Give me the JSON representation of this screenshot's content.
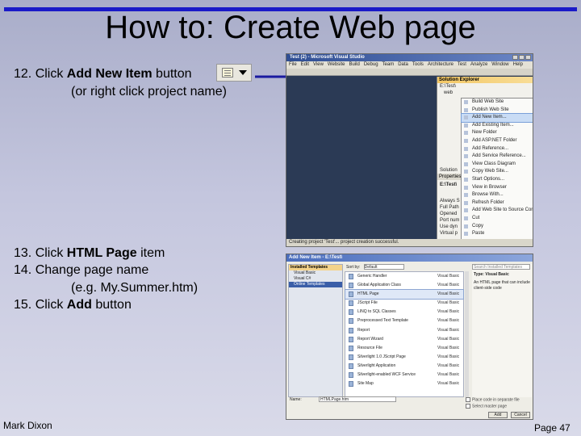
{
  "slide": {
    "title": "How to: Create Web page",
    "step12_prefix": "12. Click ",
    "step12_bold": "Add New Item",
    "step12_suffix": " button",
    "step12_note": "(or right click project name)",
    "step13_prefix": "13. Click ",
    "step13_bold": "HTML Page",
    "step13_suffix": " item",
    "step14": "14. Change page name",
    "step14_example": "(e.g. My.Summer.htm)",
    "step15_prefix": "15. Click ",
    "step15_bold": "Add",
    "step15_suffix": " button",
    "author": "Mark Dixon",
    "page": "Page 47",
    "colors": {
      "rule": "#1a1ac8",
      "arrow": "#1a1aa0"
    }
  },
  "vs_window": {
    "title": "Test (2) - Microsoft Visual Studio",
    "menu": [
      "File",
      "Edit",
      "View",
      "Website",
      "Build",
      "Debug",
      "Team",
      "Data",
      "Tools",
      "Architecture",
      "Test",
      "Analyze",
      "Window",
      "Help"
    ],
    "solution_explorer": {
      "header": "Solution Explorer",
      "tree": [
        "E:\\Test\\",
        "web"
      ],
      "solution_tab": "Solution",
      "properties_header": "Properties",
      "properties_path": "E:\\Test\\",
      "property_rows": [
        "Always S",
        "Full Path",
        "Opened",
        "Port num",
        "Use dyn",
        "Virtual p"
      ]
    },
    "context_menu": [
      "Build Web Site",
      "Publish Web Site",
      "Add New Item...",
      "Add Existing Item...",
      "New Folder",
      "Add ASP.NET Folder",
      "Add Reference...",
      "Add Service Reference...",
      "View Class Diagram",
      "Copy Web Site...",
      "Start Options...",
      "View in Browser",
      "Browse With...",
      "Refresh Folder",
      "Add Web Site to Source Cont",
      "Cut",
      "Copy",
      "Paste"
    ],
    "status": "Creating project 'Test'... project creation successful."
  },
  "add_new_item_dialog": {
    "title": "Add New Item - E:\\Test\\",
    "installed_templates": "Installed Templates",
    "sidebar_items": [
      "Visual Basic",
      "Visual C#",
      "Online Templates"
    ],
    "sort_label": "Sort by:",
    "sort_value": "Default",
    "items": [
      {
        "name": "Generic Handler",
        "lang": "Visual Basic"
      },
      {
        "name": "Global Application Class",
        "lang": "Visual Basic"
      },
      {
        "name": "HTML Page",
        "lang": "Visual Basic"
      },
      {
        "name": "JScript File",
        "lang": "Visual Basic"
      },
      {
        "name": "LINQ to SQL Classes",
        "lang": "Visual Basic"
      },
      {
        "name": "Preprocessed Text Template",
        "lang": "Visual Basic"
      },
      {
        "name": "Report",
        "lang": "Visual Basic"
      },
      {
        "name": "Report Wizard",
        "lang": "Visual Basic"
      },
      {
        "name": "Resource File",
        "lang": "Visual Basic"
      },
      {
        "name": "Silverlight 1.0 JScript Page",
        "lang": "Visual Basic"
      },
      {
        "name": "Silverlight Application",
        "lang": "Visual Basic"
      },
      {
        "name": "Silverlight-enabled WCF Service",
        "lang": "Visual Basic"
      },
      {
        "name": "Site Map",
        "lang": "Visual Basic"
      }
    ],
    "search_placeholder": "Search Installed Templates",
    "type_label": "Type: Visual Basic",
    "description": "An HTML page that can include client-side code",
    "name_label": "Name:",
    "name_value": "HTMLPage.htm",
    "check_separate": "Place code in separate file",
    "check_master": "Select master page",
    "add_button": "Add",
    "cancel_button": "Cancel"
  }
}
